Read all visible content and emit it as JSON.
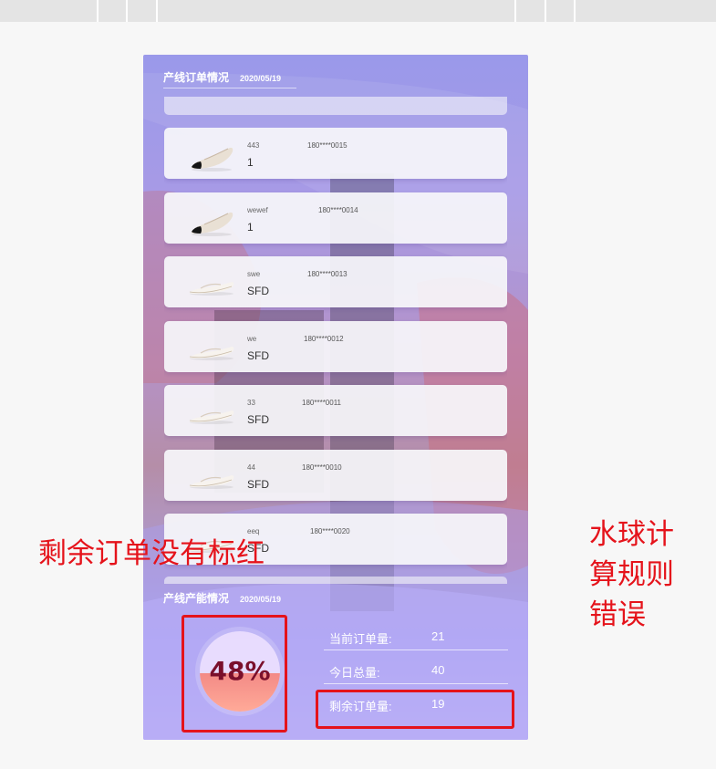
{
  "production_orders": {
    "title": "产线订单情况",
    "date": "2020/05/19",
    "orders": [
      {
        "name": "443",
        "phone": "180****0015",
        "qty": "1",
        "shoe": "black-toe-flat"
      },
      {
        "name": "wewef",
        "phone": "180****0014",
        "qty": "1",
        "shoe": "black-toe-flat"
      },
      {
        "name": "swe",
        "phone": "180****0013",
        "qty": "SFD",
        "shoe": "white-mule"
      },
      {
        "name": "we",
        "phone": "180****0012",
        "qty": "SFD",
        "shoe": "white-mule"
      },
      {
        "name": "33",
        "phone": "180****0011",
        "qty": "SFD",
        "shoe": "white-mule"
      },
      {
        "name": "44",
        "phone": "180****0010",
        "qty": "SFD",
        "shoe": "white-mule"
      },
      {
        "name": "eeq",
        "phone": "180****0020",
        "qty": "SFD",
        "shoe": "white-mule"
      }
    ]
  },
  "capacity": {
    "title": "产线产能情况",
    "date": "2020/05/19",
    "water_ball_percent": "48%",
    "water_ball_fill": 0.48,
    "stats": [
      {
        "label": "当前订单量:",
        "value": "21"
      },
      {
        "label": "今日总量:",
        "value": "40"
      },
      {
        "label": "剩余订单量:",
        "value": "19"
      }
    ]
  },
  "annotations": {
    "remaining_not_red": "剩余订单没有标红",
    "ball_rule_wrong": [
      "水球计",
      "算规则",
      "错误"
    ],
    "color": "#e5131b"
  }
}
